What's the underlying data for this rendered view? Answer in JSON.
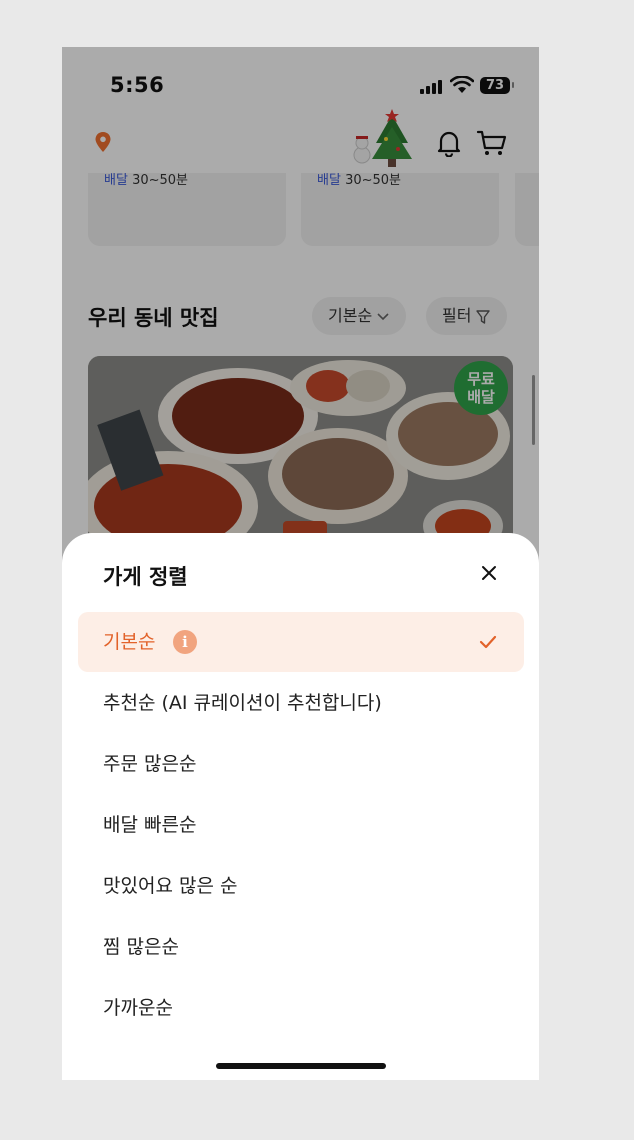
{
  "status": {
    "time": "5:56",
    "battery": "73"
  },
  "stores": [
    {
      "delivery_label": "배달",
      "delivery_time": "30~50분"
    },
    {
      "delivery_label": "배달",
      "delivery_time": "30~50분"
    }
  ],
  "section": {
    "title": "우리 동네 맛집",
    "sort_chip": "기본순",
    "filter_chip": "필터",
    "badge_line1": "무료",
    "badge_line2": "배달"
  },
  "sheet": {
    "title": "가게 정렬",
    "options": [
      {
        "label": "기본순",
        "selected": true
      },
      {
        "label": "추천순 (AI 큐레이션이 추천합니다)"
      },
      {
        "label": "주문 많은순"
      },
      {
        "label": "배달 빠른순"
      },
      {
        "label": "맛있어요 많은 순"
      },
      {
        "label": "찜 많은순"
      },
      {
        "label": "가까운순"
      }
    ]
  },
  "colors": {
    "accent": "#e2622a",
    "selected_bg": "#fdeee6",
    "free_badge": "#2fa34a"
  }
}
